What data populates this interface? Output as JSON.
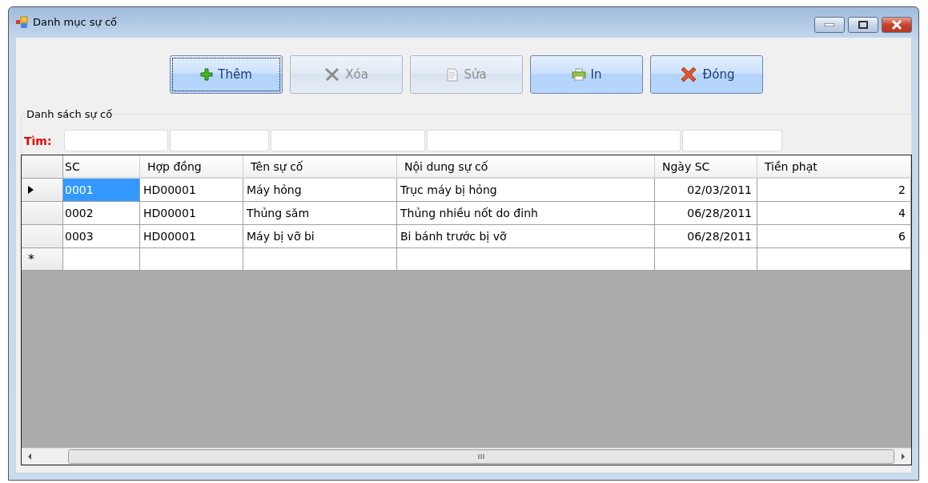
{
  "window": {
    "title": "Danh mục sự cố"
  },
  "toolbar": [
    {
      "label": "Thêm",
      "kind": "add",
      "disabled": false,
      "focused": true
    },
    {
      "label": "Xóa",
      "kind": "delete",
      "disabled": true,
      "focused": false
    },
    {
      "label": "Sửa",
      "kind": "edit",
      "disabled": true,
      "focused": false
    },
    {
      "label": "In",
      "kind": "print",
      "disabled": false,
      "focused": false
    },
    {
      "label": "Đóng",
      "kind": "close",
      "disabled": false,
      "focused": false
    }
  ],
  "group": {
    "title": "Danh sách sự cố"
  },
  "search": {
    "label": "Tìm:"
  },
  "table": {
    "columns": [
      "SC",
      "Hợp đồng",
      "Tên sự cố",
      "Nội dung sự cố",
      "Ngày SC",
      "Tiền phạt"
    ],
    "rows": [
      {
        "selected": true,
        "cells": [
          "0001",
          "HD00001",
          "Máy hỏng",
          "Trục máy bị hỏng",
          "02/03/2011",
          "2"
        ]
      },
      {
        "selected": false,
        "cells": [
          "0002",
          "HD00001",
          "Thủng săm",
          "Thủng nhiều nốt do đinh",
          "06/28/2011",
          "4"
        ]
      },
      {
        "selected": false,
        "cells": [
          "0003",
          "HD00001",
          "Máy bị vỡ bi",
          "Bi bánh trước bị vỡ",
          "06/28/2011",
          "6"
        ]
      }
    ],
    "new_row_marker": "*"
  }
}
